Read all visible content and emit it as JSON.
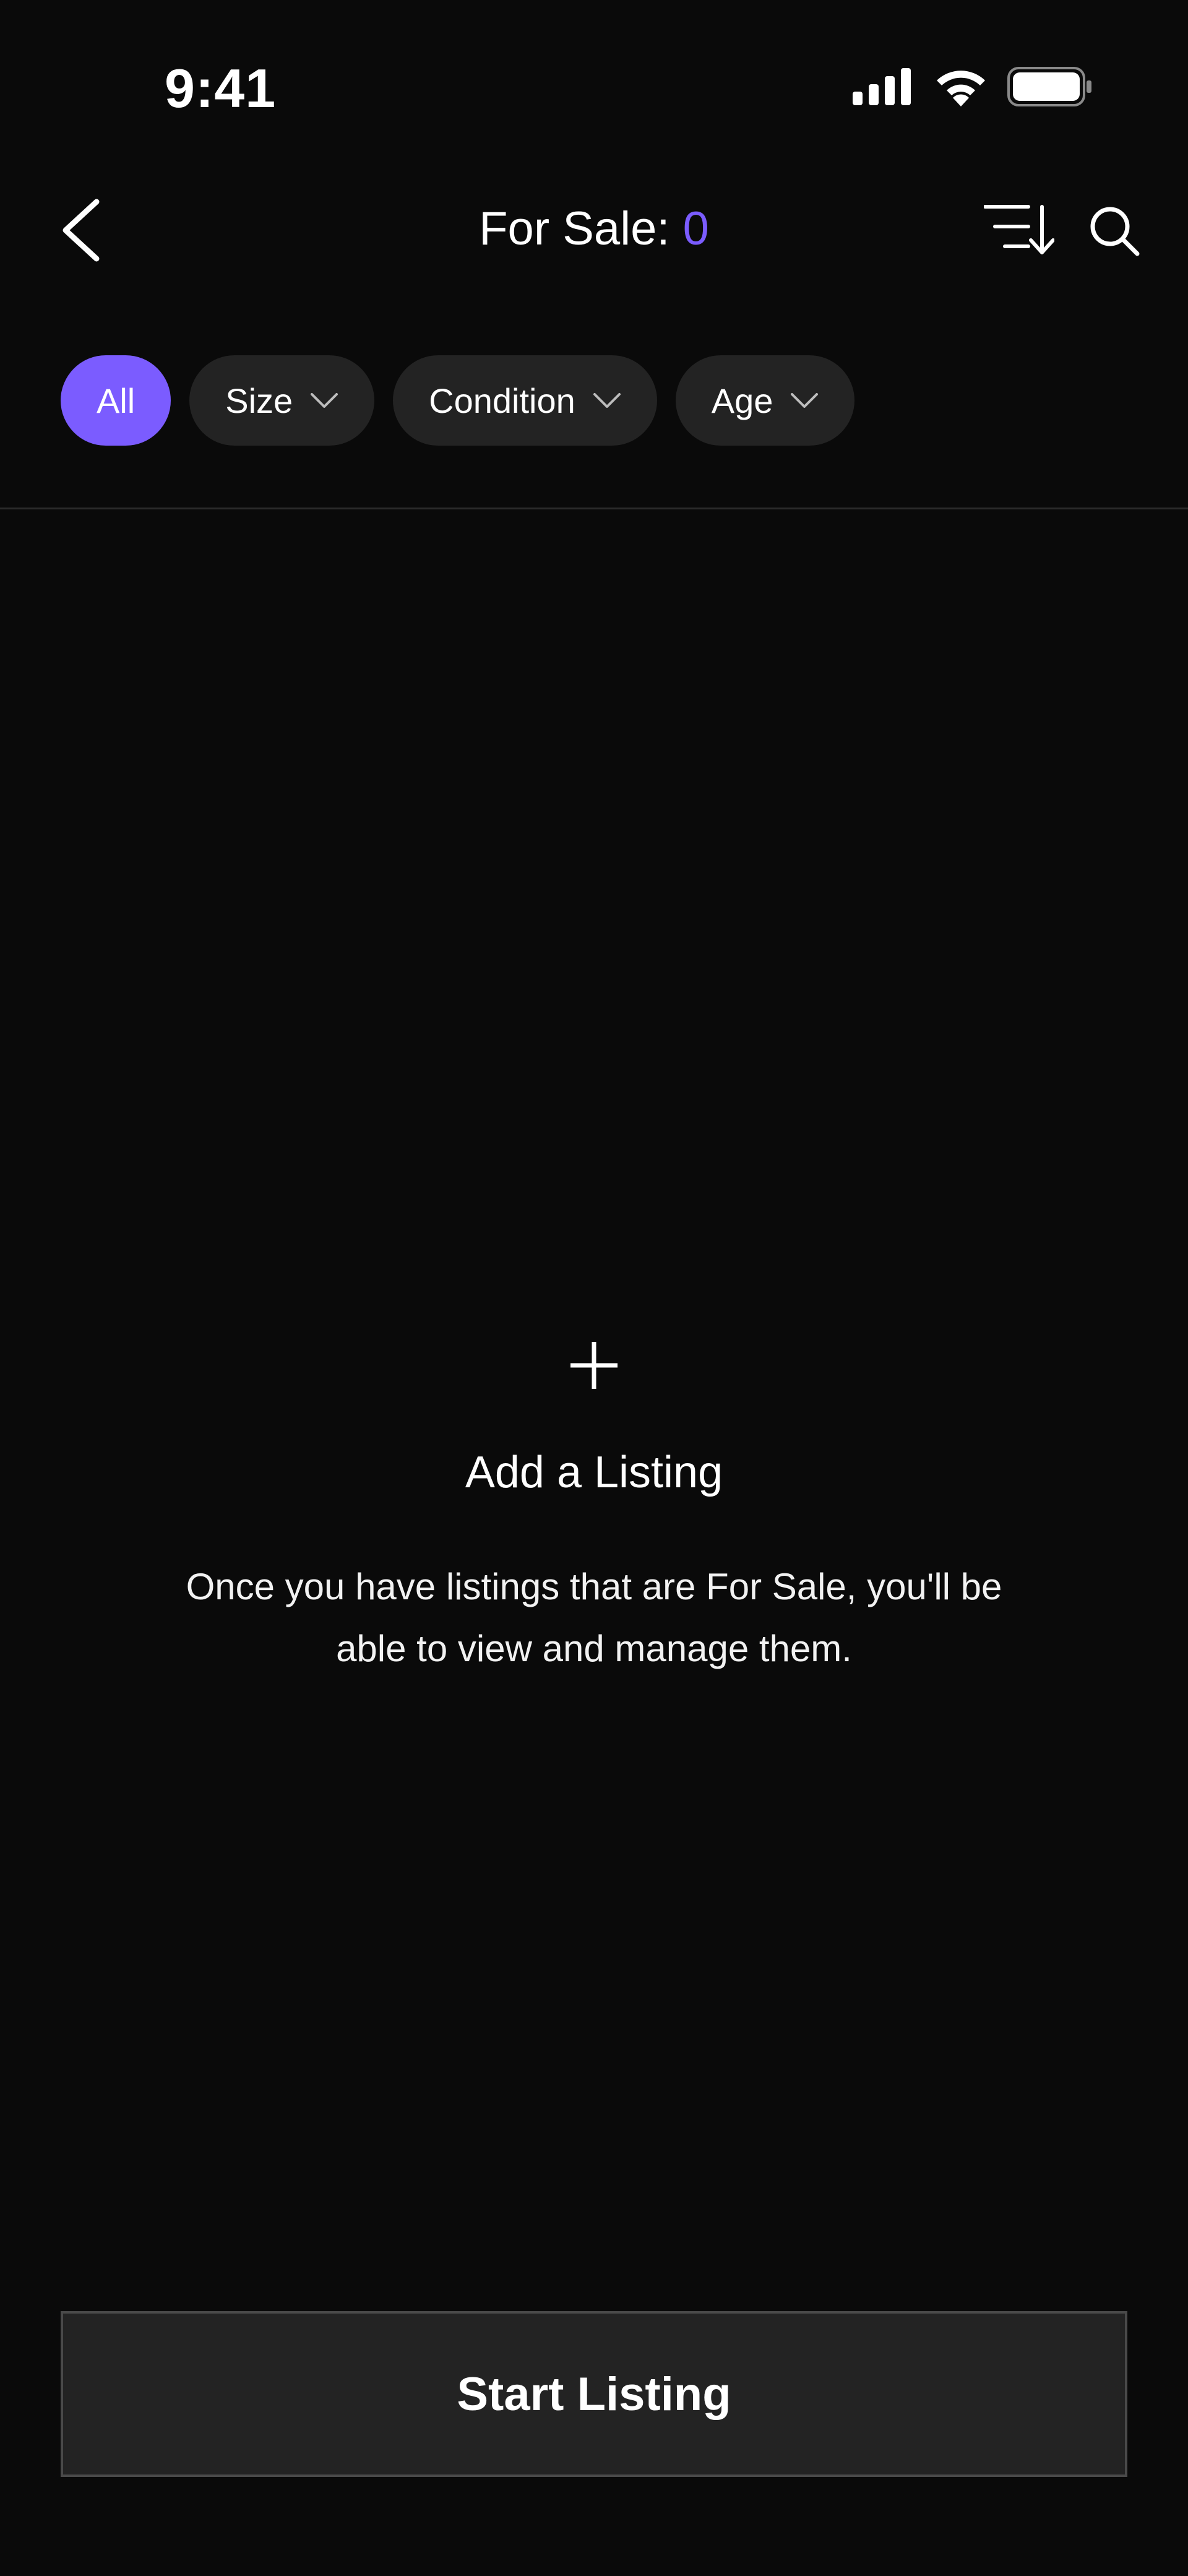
{
  "status_bar": {
    "time": "9:41",
    "icons": [
      "signal-icon",
      "wifi-icon",
      "battery-icon"
    ]
  },
  "header": {
    "title_prefix": "For Sale: ",
    "count": "0",
    "icons": [
      "back-icon",
      "sort-icon",
      "search-icon"
    ]
  },
  "filters": [
    {
      "label": "All",
      "active": true
    },
    {
      "label": "Size",
      "dropdown": true
    },
    {
      "label": "Condition",
      "dropdown": true
    },
    {
      "label": "Age",
      "dropdown": true
    }
  ],
  "empty_state": {
    "icon": "plus-icon",
    "title": "Add a Listing",
    "description": "Once you have listings that are For Sale, you'll be able to view and manage them."
  },
  "footer": {
    "button_label": "Start Listing"
  },
  "colors": {
    "background": "#0a0a0a",
    "accent": "#7b5cff",
    "chip": "#232323"
  }
}
